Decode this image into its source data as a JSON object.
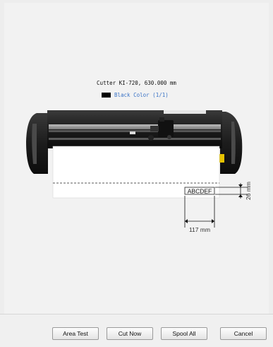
{
  "preview": {
    "device_line": "Cutter KI-720,  630.000 mm",
    "color_swatch": "#000000",
    "color_label": "Black Color (1/1)",
    "sample_text": "ABCDEF",
    "height_dimension": "26 mm",
    "width_dimension": "117 mm"
  },
  "buttons": {
    "area_test": "Area Test",
    "cut_now": "Cut Now",
    "spool_all": "Spool All",
    "cancel": "Cancel"
  },
  "icons": {
    "cutter": "vinyl-cutter-image"
  }
}
